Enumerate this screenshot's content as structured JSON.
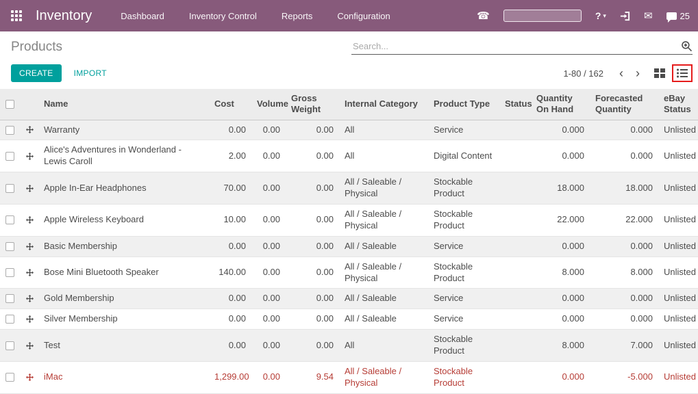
{
  "nav": {
    "app_name": "Inventory",
    "menu_items": [
      "Dashboard",
      "Inventory Control",
      "Reports",
      "Configuration"
    ],
    "message_count": "25"
  },
  "icons": {
    "phone": "☎",
    "mail": "✉",
    "help": "?",
    "caret": "▾",
    "pager_prev": "‹",
    "pager_next": "›"
  },
  "page": {
    "title": "Products",
    "search_placeholder": "Search..."
  },
  "toolbar": {
    "create_label": "CREATE",
    "import_label": "IMPORT",
    "pager_text": "1-80 / 162"
  },
  "colors": {
    "navbar": "#875A7B",
    "primary": "#00A09D",
    "danger_text": "#B63C35"
  },
  "table": {
    "headers": [
      "Name",
      "Cost",
      "Volume",
      "Gross Weight",
      "Internal Category",
      "Product Type",
      "Status",
      "Quantity On Hand",
      "Forecasted Quantity",
      "eBay Status"
    ],
    "rows": [
      {
        "name": "Warranty",
        "cost": "0.00",
        "volume": "0.00",
        "gross_weight": "0.00",
        "category": "All",
        "product_type": "Service",
        "status": "",
        "qty_on_hand": "0.000",
        "forecasted": "0.000",
        "ebay_status": "Unlisted",
        "danger": false
      },
      {
        "name": "Alice's Adventures in Wonderland - Lewis Caroll",
        "cost": "2.00",
        "volume": "0.00",
        "gross_weight": "0.00",
        "category": "All",
        "product_type": "Digital Content",
        "status": "",
        "qty_on_hand": "0.000",
        "forecasted": "0.000",
        "ebay_status": "Unlisted",
        "danger": false
      },
      {
        "name": "Apple In-Ear Headphones",
        "cost": "70.00",
        "volume": "0.00",
        "gross_weight": "0.00",
        "category": "All / Saleable / Physical",
        "product_type": "Stockable Product",
        "status": "",
        "qty_on_hand": "18.000",
        "forecasted": "18.000",
        "ebay_status": "Unlisted",
        "danger": false
      },
      {
        "name": "Apple Wireless Keyboard",
        "cost": "10.00",
        "volume": "0.00",
        "gross_weight": "0.00",
        "category": "All / Saleable / Physical",
        "product_type": "Stockable Product",
        "status": "",
        "qty_on_hand": "22.000",
        "forecasted": "22.000",
        "ebay_status": "Unlisted",
        "danger": false
      },
      {
        "name": "Basic Membership",
        "cost": "0.00",
        "volume": "0.00",
        "gross_weight": "0.00",
        "category": "All / Saleable",
        "product_type": "Service",
        "status": "",
        "qty_on_hand": "0.000",
        "forecasted": "0.000",
        "ebay_status": "Unlisted",
        "danger": false
      },
      {
        "name": "Bose Mini Bluetooth Speaker",
        "cost": "140.00",
        "volume": "0.00",
        "gross_weight": "0.00",
        "category": "All / Saleable / Physical",
        "product_type": "Stockable Product",
        "status": "",
        "qty_on_hand": "8.000",
        "forecasted": "8.000",
        "ebay_status": "Unlisted",
        "danger": false
      },
      {
        "name": "Gold Membership",
        "cost": "0.00",
        "volume": "0.00",
        "gross_weight": "0.00",
        "category": "All / Saleable",
        "product_type": "Service",
        "status": "",
        "qty_on_hand": "0.000",
        "forecasted": "0.000",
        "ebay_status": "Unlisted",
        "danger": false
      },
      {
        "name": "Silver Membership",
        "cost": "0.00",
        "volume": "0.00",
        "gross_weight": "0.00",
        "category": "All / Saleable",
        "product_type": "Service",
        "status": "",
        "qty_on_hand": "0.000",
        "forecasted": "0.000",
        "ebay_status": "Unlisted",
        "danger": false
      },
      {
        "name": "Test",
        "cost": "0.00",
        "volume": "0.00",
        "gross_weight": "0.00",
        "category": "All",
        "product_type": "Stockable Product",
        "status": "",
        "qty_on_hand": "8.000",
        "forecasted": "7.000",
        "ebay_status": "Unlisted",
        "danger": false
      },
      {
        "name": "iMac",
        "cost": "1,299.00",
        "volume": "0.00",
        "gross_weight": "9.54",
        "category": "All / Saleable / Physical",
        "product_type": "Stockable Product",
        "status": "",
        "qty_on_hand": "0.000",
        "forecasted": "-5.000",
        "ebay_status": "Unlisted",
        "danger": true
      }
    ]
  }
}
